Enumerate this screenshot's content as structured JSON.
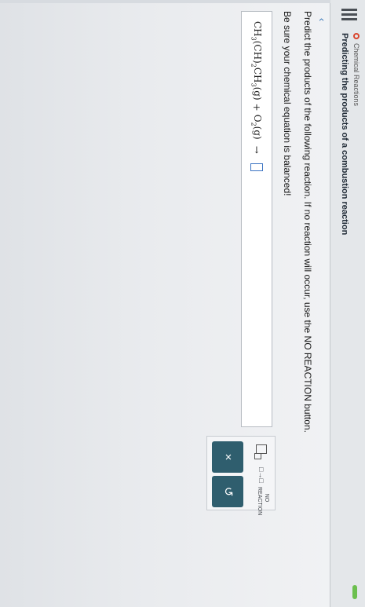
{
  "header": {
    "topic": "Chemical Reactions",
    "subtopic": "Predicting the products of a combustion reaction"
  },
  "question": {
    "prompt": "Predict the products of the following reaction. If no reaction will occur, use the NO REACTION button.",
    "balance_note": "Be sure your chemical equation is balanced!"
  },
  "equation": {
    "reactant1_main": "CH",
    "reactant1_sub1": "3",
    "reactant1_paren": "(CH)",
    "reactant1_sub2": "2",
    "reactant1_tail": "CH",
    "reactant1_sub3": "3",
    "reactant1_state": "(g)",
    "plus": "+",
    "reactant2_main": "O",
    "reactant2_sub": "2",
    "reactant2_state": "(g)",
    "arrow": "→"
  },
  "tools": {
    "reaction_arrow": "□→□",
    "no_reaction_line1": "NO",
    "no_reaction_line2": "REACTION",
    "clear_icon": "×",
    "undo_icon": "↺"
  },
  "colors": {
    "accent_button": "#2f5e6e",
    "status": "#6bbf4e",
    "topic_dot": "#d9452e"
  }
}
